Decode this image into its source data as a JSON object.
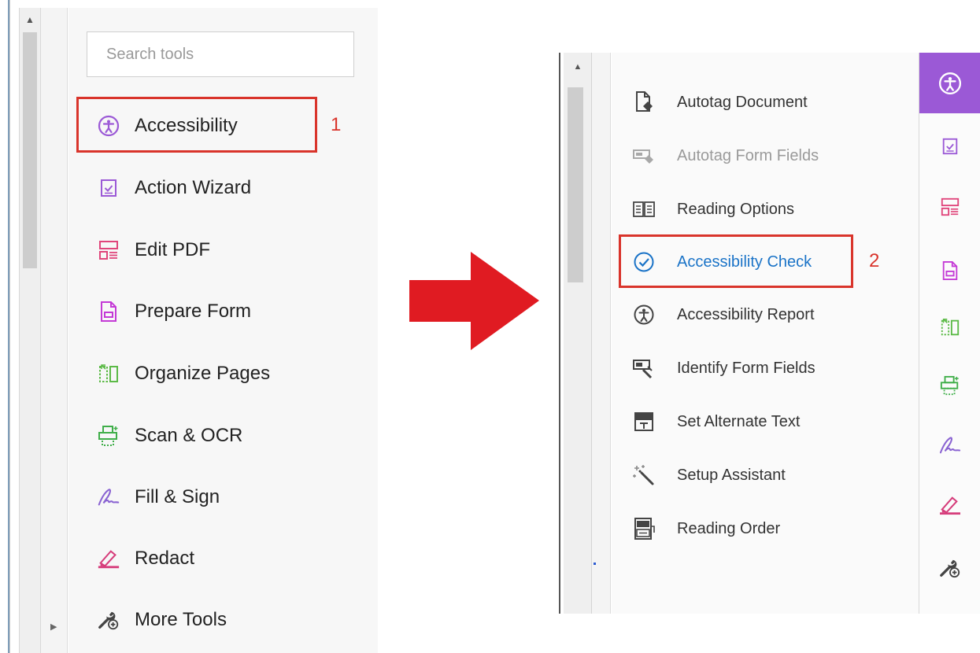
{
  "left_panel": {
    "search_placeholder": "Search tools",
    "tools": [
      {
        "label": "Accessibility",
        "icon": "accessibility-icon"
      },
      {
        "label": "Action Wizard",
        "icon": "action-wizard-icon"
      },
      {
        "label": "Edit PDF",
        "icon": "edit-pdf-icon"
      },
      {
        "label": "Prepare Form",
        "icon": "prepare-form-icon"
      },
      {
        "label": "Organize Pages",
        "icon": "organize-pages-icon"
      },
      {
        "label": "Scan & OCR",
        "icon": "scan-ocr-icon"
      },
      {
        "label": "Fill & Sign",
        "icon": "fill-sign-icon"
      },
      {
        "label": "Redact",
        "icon": "redact-icon"
      },
      {
        "label": "More Tools",
        "icon": "more-tools-icon"
      }
    ],
    "step_number": "1"
  },
  "right_panel": {
    "items": [
      {
        "label": "Autotag Document",
        "icon": "autotag-document-icon",
        "state": "enabled"
      },
      {
        "label": "Autotag Form Fields",
        "icon": "autotag-form-fields-icon",
        "state": "disabled"
      },
      {
        "label": "Reading Options",
        "icon": "reading-options-icon",
        "state": "enabled"
      },
      {
        "label": "Accessibility Check",
        "icon": "check-circle-icon",
        "state": "highlighted"
      },
      {
        "label": "Accessibility Report",
        "icon": "accessibility-report-icon",
        "state": "enabled"
      },
      {
        "label": "Identify Form Fields",
        "icon": "identify-form-fields-icon",
        "state": "enabled"
      },
      {
        "label": "Set Alternate Text",
        "icon": "alternate-text-icon",
        "state": "enabled"
      },
      {
        "label": "Setup Assistant",
        "icon": "magic-wand-icon",
        "state": "enabled"
      },
      {
        "label": "Reading Order",
        "icon": "reading-order-icon",
        "state": "enabled"
      }
    ],
    "step_number": "2",
    "rail_icons": [
      "accessibility-icon",
      "action-wizard-icon",
      "edit-pdf-icon",
      "prepare-form-icon",
      "organize-pages-icon",
      "scan-ocr-icon",
      "fill-sign-icon",
      "redact-icon",
      "more-tools-icon"
    ]
  },
  "colors": {
    "highlight_box": "#d9342b",
    "arrow": "#e01b22",
    "accessibility_purple": "#9b59d6",
    "active_link_blue": "#1a73c7"
  }
}
